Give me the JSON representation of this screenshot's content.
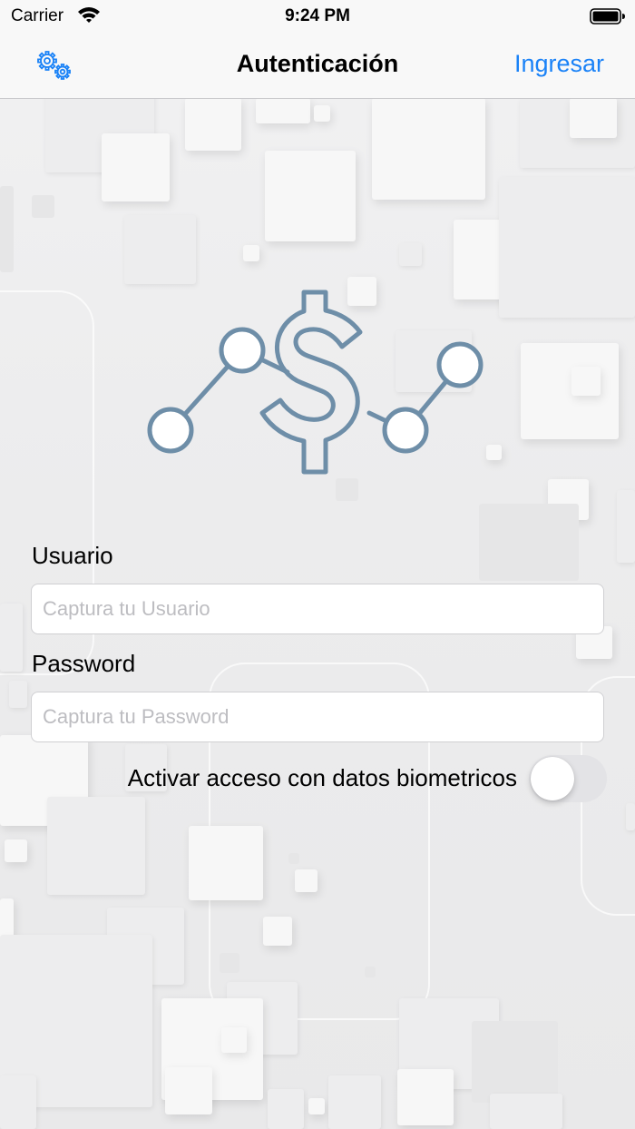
{
  "status_bar": {
    "carrier": "Carrier",
    "time": "9:24 PM",
    "icons": [
      "wifi-icon",
      "battery-icon"
    ]
  },
  "nav": {
    "title": "Autenticación",
    "left_icon": "gears-icon",
    "right_button": "Ingresar"
  },
  "logo": {
    "icon": "dollar-network-logo"
  },
  "form": {
    "username": {
      "label": "Usuario",
      "placeholder": "Captura tu Usuario",
      "value": ""
    },
    "password": {
      "label": "Password",
      "placeholder": "Captura tu Password",
      "value": ""
    },
    "biometric": {
      "label": "Activar acceso con datos biometricos",
      "enabled": false
    }
  },
  "colors": {
    "accent": "#1a82f7",
    "logo_stroke": "#6e8ea8"
  }
}
